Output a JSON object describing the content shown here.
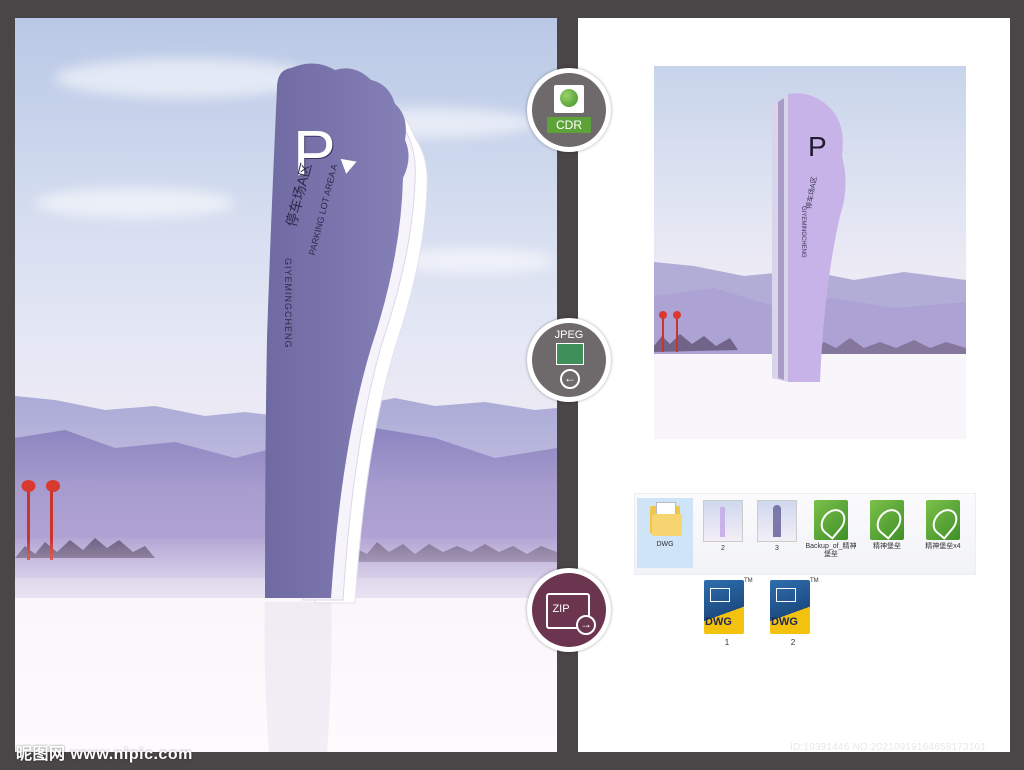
{
  "left_sign": {
    "letter": "P",
    "title_cn": "停车场A区",
    "title_en": "PARKING LOT AREA A",
    "vertical_text": "GIYEMINGCHENG"
  },
  "preview_sign": {
    "letter": "P",
    "title_cn": "停车场A区",
    "vertical_text": "GIYEMINGCHENG"
  },
  "badges": {
    "cdr": "CDR",
    "jpeg": "JPEG",
    "zip": "ZIP"
  },
  "files": [
    {
      "label": "DWG",
      "icon": "folder-icon"
    },
    {
      "label": "2",
      "icon": "image-thumbnail-icon"
    },
    {
      "label": "3",
      "icon": "image-thumbnail-icon"
    },
    {
      "label": "Backup_of_精神堡垒",
      "icon": "coreldraw-file-icon"
    },
    {
      "label": "精神堡垒",
      "icon": "coreldraw-file-icon"
    },
    {
      "label": "精神堡垒x4",
      "icon": "coreldraw-file-icon"
    }
  ],
  "dwg_files": [
    {
      "label": "1",
      "badge": "DWG",
      "tm": "TM"
    },
    {
      "label": "2",
      "badge": "DWG",
      "tm": "TM"
    }
  ],
  "watermark": "昵图网 www.nipic.com",
  "id_line": "ID:19391446 NO:20210919164658173101",
  "colors": {
    "background": "#4a4546",
    "sign_purple": "#7b77a8",
    "sign_light": "#c8b8e8",
    "badge_gray": "#6e6a6b",
    "badge_zip": "#6b3550",
    "cdr_green": "#5ea33a",
    "dwg_yellow": "#f2c20f"
  }
}
